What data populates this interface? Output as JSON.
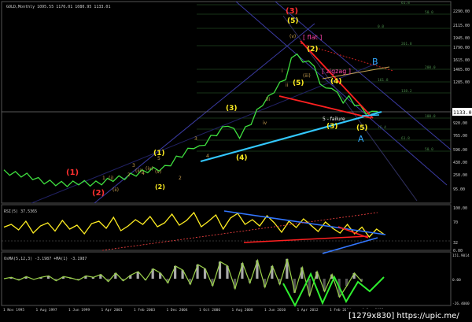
{
  "header": {
    "main": "GOLD,Monthly  1095.55 1170.01 1080.95 1133.01",
    "rsi": "RSI(5) 37.5365",
    "osma": "OsMA(5,12,3) -3.1987   +MA(1) -3.1987"
  },
  "watermark": "[1279x830] https://upic.me/",
  "price_axis": {
    "labels": [
      "2290.00",
      "2115.00",
      "1945.00",
      "1790.00",
      "1615.00",
      "1465.00",
      "1285.00",
      "1133.01",
      "920.00",
      "765.00",
      "596.00",
      "430.00",
      "250.00",
      "95.00"
    ],
    "current": "1133.01",
    "rsi_labels": [
      "100.00",
      "70",
      "32",
      "0.00"
    ],
    "osma_labels": [
      "151.9014",
      "0.00",
      "-26.4000"
    ]
  },
  "date_axis": {
    "labels": [
      "1 Nov 1995",
      "1 Aug 1997",
      "1 Jun 1999",
      "1 Apr 2001",
      "1 Feb 2003",
      "1 Dec 2004",
      "1 Oct 2006",
      "1 Aug 2008",
      "1 Jun 2010",
      "1 Apr 2012",
      "1 Feb 2014",
      "1 Dec 2015"
    ]
  },
  "waves": {
    "red": [
      "(1)",
      "(2)",
      "(3)"
    ],
    "yellow": [
      "(1)",
      "(2)",
      "(3)",
      "(4)",
      "(5)",
      "(4)",
      "(5)",
      "(2)",
      "(5)",
      "(3)",
      "(4)",
      "(5)"
    ],
    "small": [
      "1",
      "2",
      "3",
      "4",
      "5",
      "(i)",
      "(ii)",
      "(iii)",
      "(iv)",
      "(v)",
      "iii",
      "iv",
      "i",
      "ii",
      "(v)",
      "(iii)"
    ],
    "flat": "[ flat ]",
    "zigzag": "[ zigzag ]",
    "failure": "5 - failure",
    "A": "A",
    "B": "B"
  },
  "fib": [
    "50.0",
    "61.8",
    "76.4",
    "100.0",
    "138.2",
    "161.8",
    "200.0",
    "261.8",
    "0.0"
  ],
  "chart_data": {
    "type": "line",
    "title": "GOLD,Monthly",
    "ylim": [
      95,
      2290
    ],
    "price": [
      400,
      390,
      380,
      370,
      360,
      340,
      310,
      290,
      280,
      270,
      265,
      260,
      270,
      280,
      275,
      265,
      270,
      280,
      300,
      320,
      330,
      340,
      360,
      380,
      400,
      420,
      430,
      440,
      450,
      500,
      560,
      600,
      650,
      700,
      680,
      740,
      800,
      850,
      900,
      960,
      880,
      820,
      900,
      980,
      1100,
      1200,
      1260,
      1350,
      1420,
      1500,
      1700,
      1800,
      1650,
      1720,
      1600,
      1450,
      1350,
      1400,
      1300,
      1230,
      1260,
      1200,
      1150,
      1100,
      1080,
      1133
    ],
    "series": [
      {
        "name": "RSI(5)",
        "values": [
          55,
          62,
          48,
          70,
          40,
          58,
          66,
          45,
          72,
          50,
          60,
          38,
          64,
          70,
          52,
          80,
          46,
          58,
          74,
          62,
          82,
          56,
          66,
          88,
          60,
          72,
          92,
          56,
          70,
          86,
          50,
          78,
          90,
          62,
          74,
          58,
          84,
          66,
          42,
          70,
          54,
          76,
          60,
          44,
          68,
          52,
          40,
          62,
          38,
          55,
          30,
          50,
          37
        ]
      },
      {
        "name": "OsMA(5,12,3)",
        "values": [
          0,
          2,
          -2,
          3,
          -1,
          2,
          4,
          -3,
          3,
          1,
          -2,
          4,
          2,
          6,
          -4,
          8,
          -3,
          5,
          10,
          -2,
          14,
          8,
          -6,
          18,
          12,
          -8,
          20,
          14,
          -10,
          24,
          18,
          -14,
          22,
          -6,
          26,
          -12,
          18,
          -8,
          28,
          -20,
          16,
          -24,
          10,
          -18,
          6,
          -26,
          -10,
          8,
          -4
        ]
      }
    ]
  }
}
